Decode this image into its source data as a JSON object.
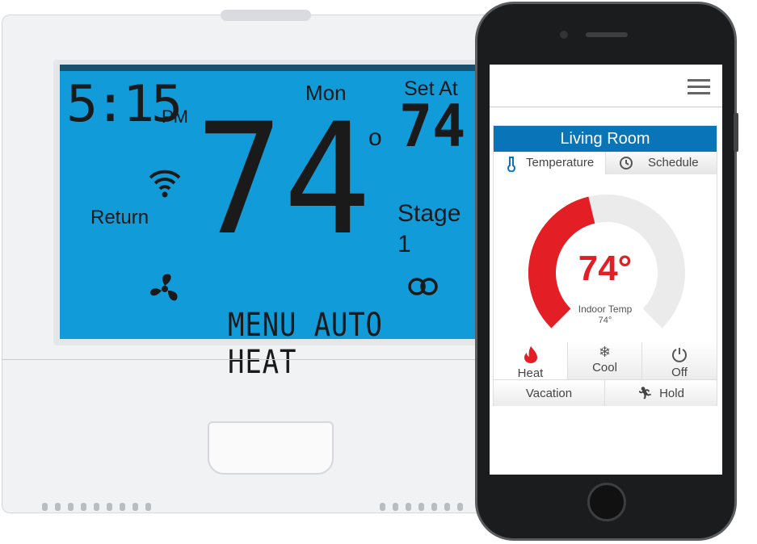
{
  "thermostat": {
    "time": "5:15",
    "ampm": "PM",
    "day": "Mon",
    "set_at_label": "Set At",
    "set_at_value": "74",
    "current_temp": "74",
    "degree": "o",
    "return_label": "Return",
    "stage_label": "Stage",
    "stage_value": "1",
    "bottom_modes": "MENU AUTO HEAT",
    "lcd_color": "#129bd9"
  },
  "app": {
    "room_title": "Living Room",
    "tabs": [
      {
        "label": "Temperature",
        "icon": "thermometer-icon",
        "active": true
      },
      {
        "label": "Schedule",
        "icon": "clock-icon",
        "active": false
      }
    ],
    "setpoint": "74°",
    "indoor_label": "Indoor Temp",
    "indoor_value": "74°",
    "gauge_fill_fraction": 0.45,
    "accent_color": "#e31e24",
    "modes": [
      {
        "label": "Heat",
        "icon": "flame-icon"
      },
      {
        "label": "Cool",
        "icon": "snowflake-icon"
      },
      {
        "label": "Off",
        "icon": "power-icon"
      }
    ],
    "actions": [
      {
        "label": "Vacation"
      },
      {
        "label": "Hold",
        "icon": "running-person-icon"
      }
    ]
  }
}
